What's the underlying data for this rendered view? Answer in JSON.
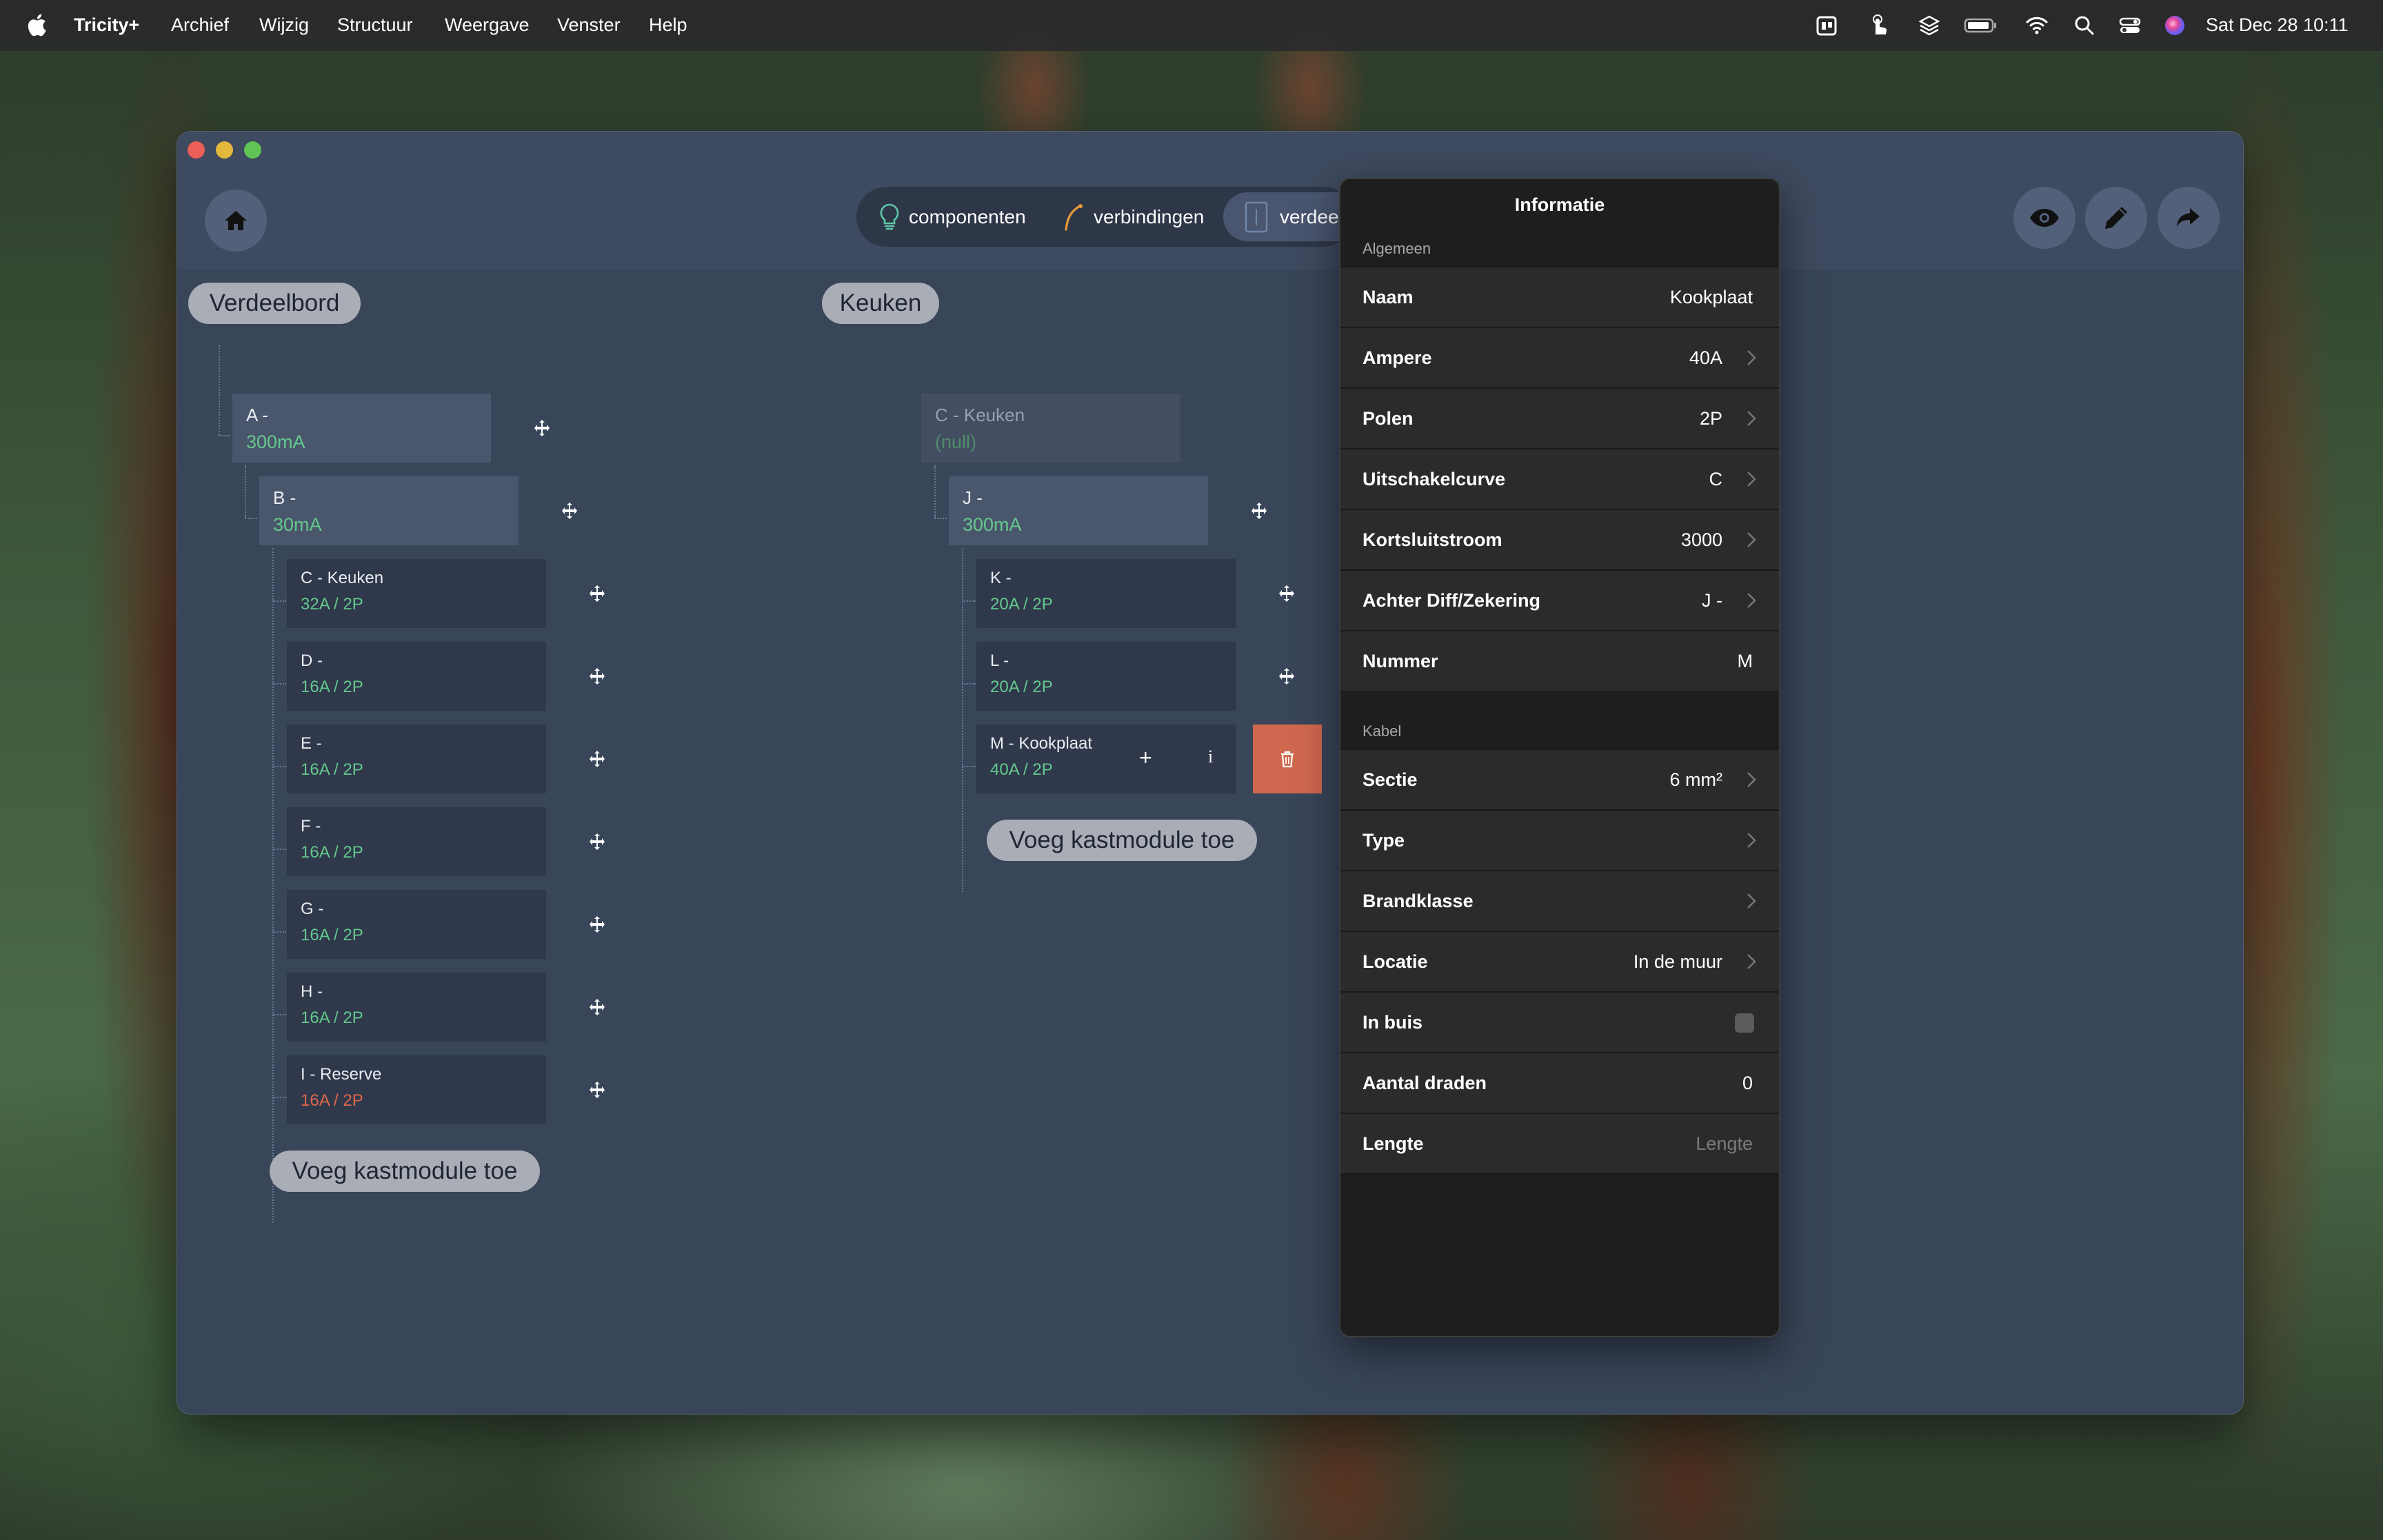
{
  "menubar": {
    "app_name": "Tricity+",
    "menus": [
      "Archief",
      "Wijzig",
      "Structuur",
      "Weergave",
      "Venster",
      "Help"
    ],
    "clock": "Sat Dec 28  10:11"
  },
  "toolbar": {
    "segments": [
      "componenten",
      "verbindingen",
      "verdee"
    ]
  },
  "boards": [
    {
      "title": "Verdeelbord",
      "root": {
        "title": "A -",
        "sub": "300mA"
      },
      "group": {
        "title": "B -",
        "sub": "30mA"
      },
      "modules": [
        {
          "title": "C - Keuken",
          "sub": "32A / 2P"
        },
        {
          "title": "D -",
          "sub": "16A / 2P"
        },
        {
          "title": "E -",
          "sub": "16A / 2P"
        },
        {
          "title": "F -",
          "sub": "16A / 2P"
        },
        {
          "title": "G -",
          "sub": "16A / 2P"
        },
        {
          "title": "H -",
          "sub": "16A / 2P"
        },
        {
          "title": "I - Reserve",
          "sub": "16A / 2P"
        }
      ],
      "add_label": "Voeg kastmodule toe"
    },
    {
      "title": "Keuken",
      "root": {
        "title": "C - Keuken",
        "sub": "(null)"
      },
      "group": {
        "title": "J -",
        "sub": "300mA"
      },
      "modules": [
        {
          "title": "K -",
          "sub": "20A / 2P"
        },
        {
          "title": "L -",
          "sub": "20A / 2P"
        },
        {
          "title": "M - Kookplaat",
          "sub": "40A / 2P"
        }
      ],
      "selected_actions": {
        "add": "+",
        "info": "i"
      },
      "add_label": "Voeg kastmodule toe"
    }
  ],
  "info_panel": {
    "title": "Informatie",
    "general_label": "Algemeen",
    "general": [
      {
        "key": "Naam",
        "value": "Kookplaat"
      },
      {
        "key": "Ampere",
        "value": "40A"
      },
      {
        "key": "Polen",
        "value": "2P"
      },
      {
        "key": "Uitschakelcurve",
        "value": "C"
      },
      {
        "key": "Kortsluitstroom",
        "value": "3000"
      },
      {
        "key": "Achter Diff/Zekering",
        "value": "J -"
      },
      {
        "key": "Nummer",
        "value": "M"
      }
    ],
    "cable_label": "Kabel",
    "cable": [
      {
        "key": "Sectie",
        "value": "6 mm²"
      },
      {
        "key": "Type",
        "value": ""
      },
      {
        "key": "Brandklasse",
        "value": ""
      },
      {
        "key": "Locatie",
        "value": "In de muur"
      },
      {
        "key": "In buis",
        "value": ""
      },
      {
        "key": "Aantal draden",
        "value": "0"
      },
      {
        "key": "Lengte",
        "value": "",
        "placeholder": "Lengte"
      }
    ]
  },
  "colors": {
    "accent_green": "#64c88e",
    "accent_red": "#e0664c",
    "delete_button": "#d0674f",
    "window_bg": "#394559"
  },
  "icons": [
    "apple-icon",
    "home-icon",
    "lightbulb-icon",
    "cable-icon",
    "board-icon",
    "eye-icon",
    "pencil-icon",
    "share-icon",
    "move-icon",
    "trash-icon",
    "chevron-right-icon"
  ]
}
